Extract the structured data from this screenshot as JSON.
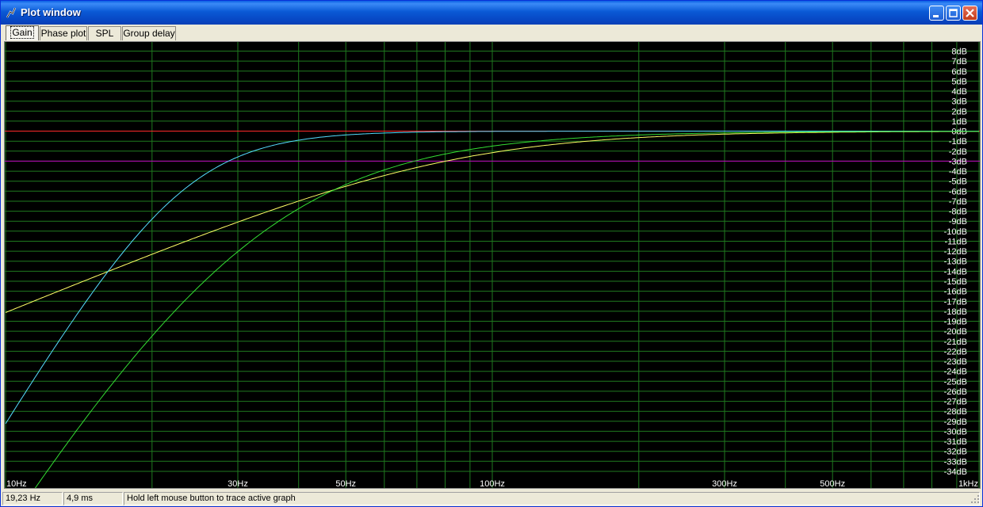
{
  "window": {
    "title": "Plot window",
    "minimize_icon": "minimize-icon",
    "maximize_icon": "maximize-icon",
    "close_icon": "close-icon"
  },
  "tabs": [
    {
      "label": "Gain",
      "active": true
    },
    {
      "label": "Phase plot",
      "active": false
    },
    {
      "label": "SPL",
      "active": false
    },
    {
      "label": "Group delay",
      "active": false
    }
  ],
  "status": {
    "frequency": "19,23 Hz",
    "time": "4,9 ms",
    "hint": "Hold left mouse button to trace active graph"
  },
  "colors": {
    "background": "#000000",
    "grid": "#1f7a1f",
    "zero_line": "#ff2a2a",
    "minus3_line": "#c000c0",
    "label": "#ffffff"
  },
  "chart_data": {
    "type": "line",
    "x_scale": "log",
    "xlim": [
      10,
      1000
    ],
    "ylim": [
      -35,
      9
    ],
    "x_tick_labels": [
      {
        "x": 10,
        "label": "10Hz"
      },
      {
        "x": 30,
        "label": "30Hz"
      },
      {
        "x": 50,
        "label": "50Hz"
      },
      {
        "x": 100,
        "label": "100Hz"
      },
      {
        "x": 300,
        "label": "300Hz"
      },
      {
        "x": 500,
        "label": "500Hz"
      },
      {
        "x": 1000,
        "label": "1kHz"
      }
    ],
    "x_gridlines": [
      10,
      20,
      30,
      40,
      50,
      60,
      70,
      80,
      90,
      100,
      200,
      300,
      400,
      500,
      600,
      700,
      800,
      900,
      1000
    ],
    "y_tick_labels": [
      "8dB",
      "7dB",
      "6dB",
      "5dB",
      "4dB",
      "3dB",
      "2dB",
      "1dB",
      "0dB",
      "-1dB",
      "-2dB",
      "-3dB",
      "-4dB",
      "-5dB",
      "-6dB",
      "-7dB",
      "-8dB",
      "-9dB",
      "-10dB",
      "-11dB",
      "-12dB",
      "-13dB",
      "-14dB",
      "-15dB",
      "-16dB",
      "-17dB",
      "-18dB",
      "-19dB",
      "-20dB",
      "-21dB",
      "-22dB",
      "-23dB",
      "-24dB",
      "-25dB",
      "-26dB",
      "-27dB",
      "-28dB",
      "-29dB",
      "-30dB",
      "-31dB",
      "-32dB",
      "-33dB",
      "-34dB"
    ],
    "y_ticks": [
      8,
      7,
      6,
      5,
      4,
      3,
      2,
      1,
      0,
      -1,
      -2,
      -3,
      -4,
      -5,
      -6,
      -7,
      -8,
      -9,
      -10,
      -11,
      -12,
      -13,
      -14,
      -15,
      -16,
      -17,
      -18,
      -19,
      -20,
      -21,
      -22,
      -23,
      -24,
      -25,
      -26,
      -27,
      -28,
      -29,
      -30,
      -31,
      -32,
      -33,
      -34
    ],
    "reference_lines": [
      {
        "y": 0,
        "color": "#ff2a2a"
      },
      {
        "y": -3,
        "color": "#c000c0"
      }
    ],
    "series": [
      {
        "color": "#ffff66",
        "fc": 80,
        "order": 1,
        "q": 0.707
      },
      {
        "color": "#55ddff",
        "fc": 23,
        "order": 4,
        "q": 0.707
      },
      {
        "color": "#33dd33",
        "fc": 30,
        "order": 4,
        "q": 0.5
      }
    ]
  }
}
